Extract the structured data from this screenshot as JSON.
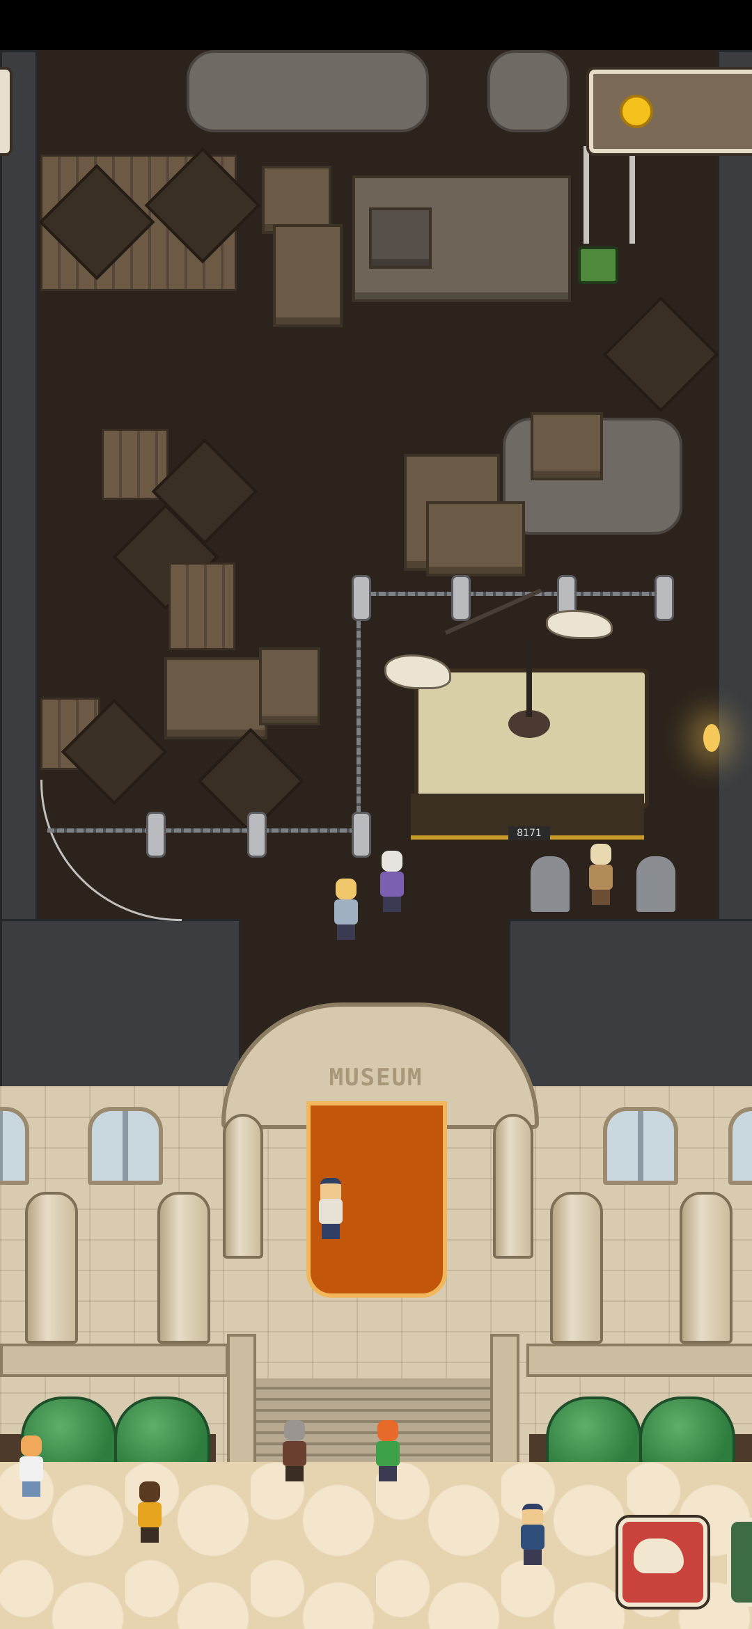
{
  "hud": {
    "coin_value": "",
    "coin_icon": "coin-icon",
    "fossil_button_icon": "fossil-skull-icon"
  },
  "building": {
    "sign": "MUSEUM"
  },
  "exhibit": {
    "plaque": "8171"
  },
  "colors": {
    "carpet": "#c2560a",
    "fossil_button": "#c9423b",
    "coin": "#f3c21c"
  }
}
